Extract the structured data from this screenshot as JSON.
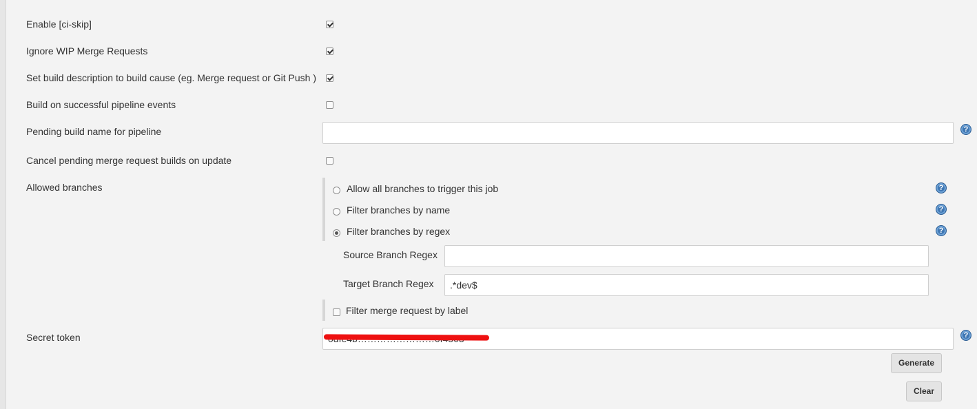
{
  "options": {
    "enable_ci_skip": {
      "label": "Enable [ci-skip]",
      "checked": true
    },
    "ignore_wip": {
      "label": "Ignore WIP Merge Requests",
      "checked": true
    },
    "set_build_description": {
      "label": "Set build description to build cause (eg. Merge request or Git Push )",
      "checked": true
    },
    "build_on_pipeline": {
      "label": "Build on successful pipeline events",
      "checked": false
    },
    "pending_build_name": {
      "label": "Pending build name for pipeline",
      "value": ""
    },
    "cancel_pending": {
      "label": "Cancel pending merge request builds on update",
      "checked": false
    }
  },
  "allowed_branches": {
    "label": "Allowed branches",
    "radios": [
      {
        "label": "Allow all branches to trigger this job",
        "selected": false
      },
      {
        "label": "Filter branches by name",
        "selected": false
      },
      {
        "label": "Filter branches by regex",
        "selected": true
      }
    ],
    "source_regex": {
      "label": "Source Branch Regex",
      "value": ""
    },
    "target_regex": {
      "label": "Target Branch Regex",
      "value": ".*dev$"
    },
    "filter_by_label": {
      "label": "Filter merge request by label",
      "checked": false
    }
  },
  "secret_token": {
    "label": "Secret token",
    "value": "0dfe4b……………………0f4503"
  },
  "buttons": {
    "generate": "Generate",
    "clear": "Clear"
  },
  "help_glyph": "?"
}
